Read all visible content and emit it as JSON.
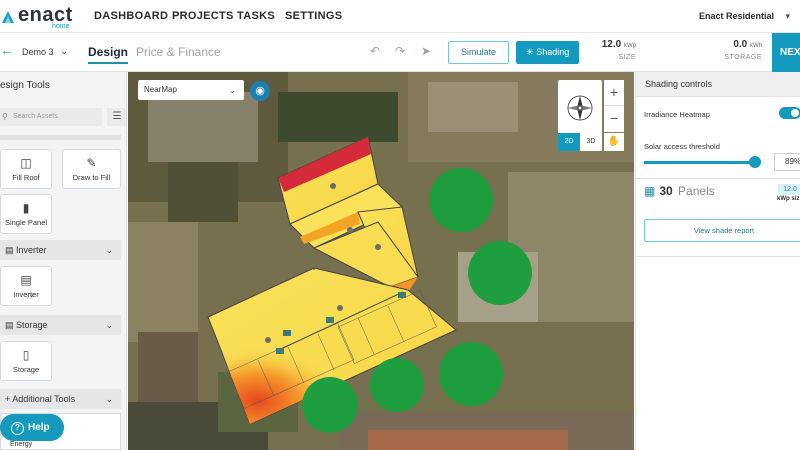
{
  "brand": {
    "name": "enact",
    "sub": "home"
  },
  "nav": {
    "items": [
      "DASHBOARD",
      "PROJECTS",
      "TASKS",
      "SETTINGS"
    ],
    "company": "Enact Residential"
  },
  "toolbar": {
    "design_name": "Demo 3",
    "tabs": [
      "Design",
      "Price & Finance"
    ],
    "simulate_label": "Simulate",
    "shading_label": "Shading",
    "size_value": "12.0",
    "size_unit": "kWp",
    "size_label": "SIZE",
    "storage_value": "0.0",
    "storage_unit": "kWh",
    "storage_label": "STORAGE",
    "next_label": "NEXT"
  },
  "sidebar": {
    "title": "esign Tools",
    "search_placeholder": "Search Assets",
    "tools": [
      "Fill Roof",
      "Draw to Fill",
      "Single Panel"
    ],
    "sections": [
      "Inverter",
      "Storage",
      "Additional Tools"
    ],
    "inverter_tile": "Inverter",
    "storage_tile": "Storage",
    "help_label": "Help",
    "energy_label": "Energy"
  },
  "map": {
    "source": "NearMap",
    "view_2d": "2D",
    "view_3d": "3D"
  },
  "shading": {
    "title": "Shading controls",
    "heatmap_label": "Irradiance Heatmap",
    "heatmap_on": true,
    "threshold_label": "Solar access threshold",
    "threshold_value": "89%",
    "threshold_fraction": 0.89,
    "panel_count": "30",
    "panel_word": "Panels",
    "kwp_value": "12.0",
    "kwp_label": "kWp siz",
    "report_label": "View shade report"
  },
  "colors": {
    "accent": "#1599bd",
    "tree": "#1e9e3e"
  }
}
